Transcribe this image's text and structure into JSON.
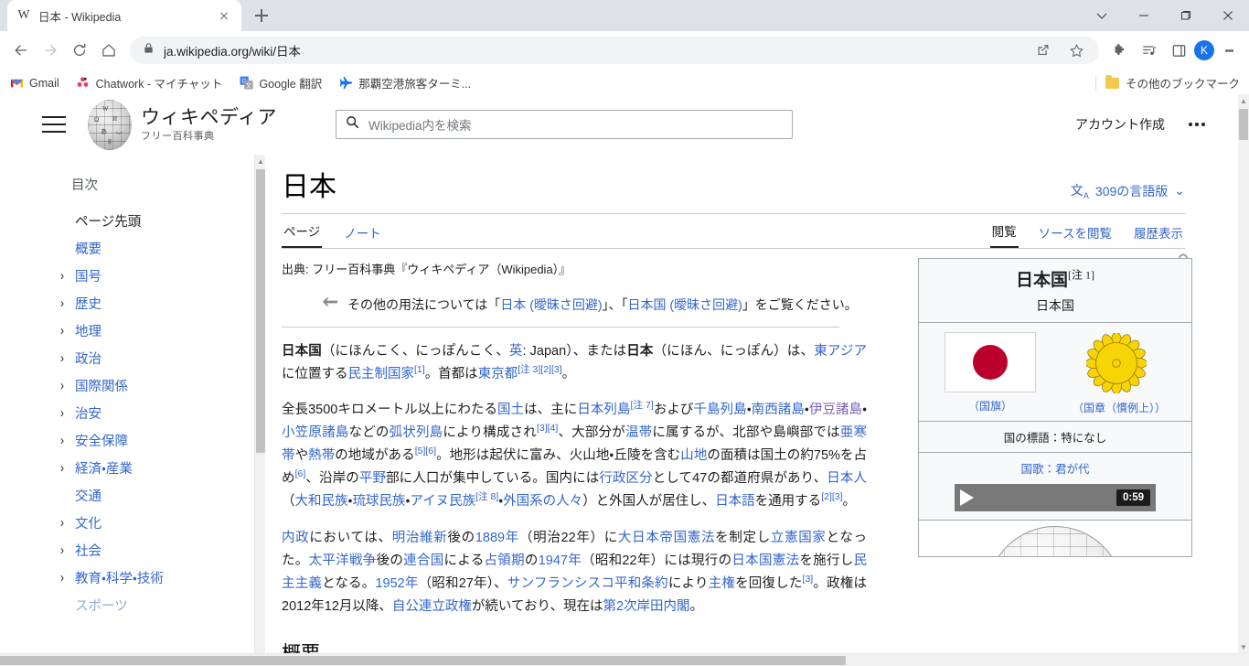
{
  "browser": {
    "tab": {
      "favicon": "wikipedia-w-icon",
      "title": "日本 - Wikipedia"
    },
    "new_tab_label": "+",
    "window_controls": {
      "minimize": "minimize-icon",
      "maximize": "maximize-icon",
      "close": "close-icon",
      "list": "tab-search-icon"
    },
    "nav": {
      "back": "back-arrow-icon",
      "forward": "forward-arrow-icon",
      "reload": "reload-icon",
      "home": "home-icon"
    },
    "omnibox": {
      "lock": "lock-icon",
      "url": "ja.wikipedia.org/wiki/日本",
      "share": "share-icon",
      "bookmark": "star-icon"
    },
    "toolbar_icons": {
      "extensions": "puzzle-piece-icon",
      "media": "media-control-icon",
      "sidepanel": "side-panel-icon",
      "menu": "kebab-menu-icon"
    },
    "profile": {
      "initial": "K",
      "color": "#1a73e8"
    },
    "bookmarks": [
      {
        "label": "Gmail",
        "icon": "gmail-icon"
      },
      {
        "label": "Chatwork - マイチャット",
        "icon": "chatwork-icon"
      },
      {
        "label": "Google 翻訳",
        "icon": "google-translate-icon"
      },
      {
        "label": "那覇空港旅客ターミ...",
        "icon": "airplane-icon"
      }
    ],
    "other_bookmarks": {
      "label": "その他のブックマーク",
      "icon": "folder-icon"
    }
  },
  "wiki": {
    "menu_icon": "hamburger-menu-icon",
    "logo": {
      "title": "ウィキペディア",
      "subtitle": "フリー百科事典",
      "icon": "wikipedia-globe-icon"
    },
    "search": {
      "placeholder": "Wikipedia内を検索",
      "icon": "search-icon"
    },
    "account": {
      "create_label": "アカウント作成",
      "more_icon": "more-options-icon"
    },
    "toc": {
      "title": "目次",
      "items": [
        {
          "label": "ページ先頭",
          "expandable": false,
          "style": "plain"
        },
        {
          "label": "概要",
          "expandable": false,
          "style": "link"
        },
        {
          "label": "国号",
          "expandable": true,
          "style": "link"
        },
        {
          "label": "歴史",
          "expandable": true,
          "style": "link"
        },
        {
          "label": "地理",
          "expandable": true,
          "style": "link"
        },
        {
          "label": "政治",
          "expandable": true,
          "style": "link"
        },
        {
          "label": "国際関係",
          "expandable": true,
          "style": "link"
        },
        {
          "label": "治安",
          "expandable": true,
          "style": "link"
        },
        {
          "label": "安全保障",
          "expandable": true,
          "style": "link"
        },
        {
          "label": "経済・産業",
          "expandable": true,
          "style": "link"
        },
        {
          "label": "交通",
          "expandable": false,
          "style": "link"
        },
        {
          "label": "文化",
          "expandable": true,
          "style": "link"
        },
        {
          "label": "社会",
          "expandable": true,
          "style": "link"
        },
        {
          "label": "教育・科学・技術",
          "expandable": true,
          "style": "link"
        },
        {
          "label": "スポーツ",
          "expandable": false,
          "style": "muted"
        }
      ]
    },
    "article": {
      "title": "日本",
      "language_button": {
        "label": "309の言語版",
        "icon": "language-icon",
        "chevron": "chevron-down-icon"
      },
      "tabs_left": [
        {
          "label": "ページ",
          "active": true
        },
        {
          "label": "ノート",
          "active": false
        }
      ],
      "tabs_right": [
        {
          "label": "閲覧",
          "active": true
        },
        {
          "label": "ソースを閲覧",
          "active": false
        },
        {
          "label": "履歴表示",
          "active": false
        }
      ],
      "source_line": "出典: フリー百科事典『ウィキペディア（Wikipedia）』",
      "protect_icon": "semi-protected-lock-icon",
      "hatnote": {
        "icon": "hatnote-arrow-icon",
        "prefix": "その他の用法については「",
        "link1": "日本 (曖昧さ回避)",
        "middle": "」、「",
        "link2": "日本国 (曖昧さ回避)",
        "suffix": "」をご覧ください。"
      },
      "section_heading": "概要"
    },
    "infobox": {
      "title": "日本国",
      "title_note": "[注 1]",
      "subtitle": "日本国",
      "flag_caption": "（国旗）",
      "emblem_caption": "（国章（慣例上））",
      "flag_icon": "japan-flag-icon",
      "emblem_icon": "chrysanthemum-seal-icon",
      "motto_row": "国の標語：特になし",
      "anthem_label": "国歌：君が代",
      "audio": {
        "play_icon": "play-icon",
        "duration": "0:59"
      },
      "map_icon": "world-globe-map-icon"
    }
  },
  "paragraphs": {
    "p1": [
      {
        "t": "日本国",
        "s": "b"
      },
      {
        "t": "（にほんこく、にっぽんこく、",
        "s": "n"
      },
      {
        "t": "英",
        "s": "a"
      },
      {
        "t": ": Japan）、または",
        "s": "n"
      },
      {
        "t": "日本",
        "s": "b"
      },
      {
        "t": "（にほん、にっぽん）は、",
        "s": "n"
      },
      {
        "t": "東アジア",
        "s": "a"
      },
      {
        "t": "に位置する",
        "s": "n"
      },
      {
        "t": "民主制国家",
        "s": "a"
      },
      {
        "t": "[1]",
        "s": "sup"
      },
      {
        "t": "。首都は",
        "s": "n"
      },
      {
        "t": "東京都",
        "s": "a"
      },
      {
        "t": "[注 3][2][3]",
        "s": "sup"
      },
      {
        "t": "。",
        "s": "n"
      }
    ],
    "p2": [
      {
        "t": "全長3500キロメートル以上にわたる",
        "s": "n"
      },
      {
        "t": "国土",
        "s": "a"
      },
      {
        "t": "は、主に",
        "s": "n"
      },
      {
        "t": "日本列島",
        "s": "a"
      },
      {
        "t": "[注 7]",
        "s": "sup"
      },
      {
        "t": "および",
        "s": "n"
      },
      {
        "t": "千島列島",
        "s": "a"
      },
      {
        "t": "・",
        "s": "n"
      },
      {
        "t": "南西諸島",
        "s": "a"
      },
      {
        "t": "・",
        "s": "n"
      },
      {
        "t": "伊豆諸島",
        "s": "av"
      },
      {
        "t": "・",
        "s": "n"
      },
      {
        "t": "小笠原諸島",
        "s": "a"
      },
      {
        "t": "などの",
        "s": "n"
      },
      {
        "t": "弧状列島",
        "s": "a"
      },
      {
        "t": "により構成され",
        "s": "n"
      },
      {
        "t": "[3][4]",
        "s": "sup"
      },
      {
        "t": "、大部分が",
        "s": "n"
      },
      {
        "t": "温帯",
        "s": "a"
      },
      {
        "t": "に属するが、北部や島嶼部では",
        "s": "n"
      },
      {
        "t": "亜寒帯",
        "s": "a"
      },
      {
        "t": "や",
        "s": "n"
      },
      {
        "t": "熱帯",
        "s": "a"
      },
      {
        "t": "の地域がある",
        "s": "n"
      },
      {
        "t": "[5][6]",
        "s": "sup"
      },
      {
        "t": "。地形は起伏に富み、火山地・丘陵を含む",
        "s": "n"
      },
      {
        "t": "山地",
        "s": "a"
      },
      {
        "t": "の面積は国土の約75%を占め",
        "s": "n"
      },
      {
        "t": "[6]",
        "s": "sup"
      },
      {
        "t": "、沿岸の",
        "s": "n"
      },
      {
        "t": "平野",
        "s": "a"
      },
      {
        "t": "部に人口が集中している。国内には",
        "s": "n"
      },
      {
        "t": "行政区分",
        "s": "a"
      },
      {
        "t": "として47の都道府県があり、",
        "s": "n"
      },
      {
        "t": "日本人",
        "s": "a"
      },
      {
        "t": "（",
        "s": "n"
      },
      {
        "t": "大和民族",
        "s": "a"
      },
      {
        "t": "・",
        "s": "n"
      },
      {
        "t": "琉球民族",
        "s": "a"
      },
      {
        "t": "・",
        "s": "n"
      },
      {
        "t": "アイヌ民族",
        "s": "a"
      },
      {
        "t": "[注 8]",
        "s": "sup"
      },
      {
        "t": "・",
        "s": "n"
      },
      {
        "t": "外国系の人々",
        "s": "a"
      },
      {
        "t": "）と外国人が居住し、",
        "s": "n"
      },
      {
        "t": "日本語",
        "s": "a"
      },
      {
        "t": "を通用する",
        "s": "n"
      },
      {
        "t": "[2][3]",
        "s": "sup"
      },
      {
        "t": "。",
        "s": "n"
      }
    ],
    "p3": [
      {
        "t": "内政",
        "s": "a"
      },
      {
        "t": "においては、",
        "s": "n"
      },
      {
        "t": "明治維新",
        "s": "a"
      },
      {
        "t": "後の",
        "s": "n"
      },
      {
        "t": "1889年",
        "s": "a"
      },
      {
        "t": "（明治22年）に",
        "s": "n"
      },
      {
        "t": "大日本帝国憲法",
        "s": "a"
      },
      {
        "t": "を制定し",
        "s": "n"
      },
      {
        "t": "立憲国家",
        "s": "a"
      },
      {
        "t": "となった。",
        "s": "n"
      },
      {
        "t": "太平洋戦争",
        "s": "a"
      },
      {
        "t": "後の",
        "s": "n"
      },
      {
        "t": "連合国",
        "s": "a"
      },
      {
        "t": "による",
        "s": "n"
      },
      {
        "t": "占領期",
        "s": "a"
      },
      {
        "t": "の",
        "s": "n"
      },
      {
        "t": "1947年",
        "s": "a"
      },
      {
        "t": "（昭和22年）には現行の",
        "s": "n"
      },
      {
        "t": "日本国憲法",
        "s": "a"
      },
      {
        "t": "を施行し",
        "s": "n"
      },
      {
        "t": "民主主義",
        "s": "a"
      },
      {
        "t": "となる。",
        "s": "n"
      },
      {
        "t": "1952年",
        "s": "a"
      },
      {
        "t": "（昭和27年）、",
        "s": "n"
      },
      {
        "t": "サンフランシスコ平和条約",
        "s": "a"
      },
      {
        "t": "により",
        "s": "n"
      },
      {
        "t": "主権",
        "s": "a"
      },
      {
        "t": "を回復した",
        "s": "n"
      },
      {
        "t": "[3]",
        "s": "sup"
      },
      {
        "t": "。政権は2012年12月以降、",
        "s": "n"
      },
      {
        "t": "自公連立政権",
        "s": "a"
      },
      {
        "t": "が続いており、現在は",
        "s": "n"
      },
      {
        "t": "第2次岸田内閣",
        "s": "a"
      },
      {
        "t": "。",
        "s": "n"
      }
    ]
  }
}
